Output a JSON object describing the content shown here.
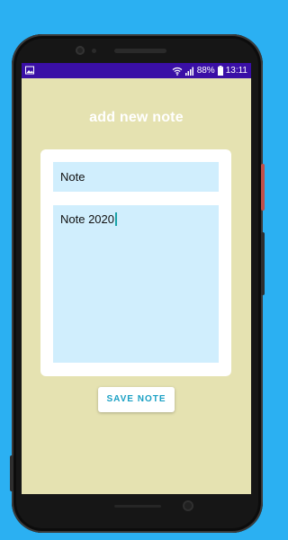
{
  "status_bar": {
    "battery": "88%",
    "time": "13:11",
    "icons": [
      "image-icon",
      "wifi-icon",
      "signal-icon",
      "battery-icon"
    ]
  },
  "page": {
    "title": "add new note"
  },
  "form": {
    "title_value": "Note",
    "body_value": "Note 2020"
  },
  "actions": {
    "save_label": "SAVE NOTE"
  },
  "colors": {
    "background": "#2bb0f2",
    "screen": "#e5e2b1",
    "status_bar": "#3a0fa6",
    "input_fill": "#d0eefd",
    "accent": "#1aa0c4"
  }
}
